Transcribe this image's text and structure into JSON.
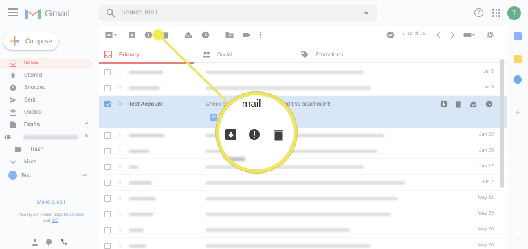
{
  "header": {
    "brand": "Gmail",
    "search_placeholder": "Search mail",
    "avatar_letter": "T"
  },
  "sidebar": {
    "compose_label": "Compose",
    "items": [
      {
        "label": "Inbox",
        "count": "",
        "icon": "inbox-icon",
        "active": true
      },
      {
        "label": "Starred",
        "count": "",
        "icon": "star-icon"
      },
      {
        "label": "Snoozed",
        "count": "",
        "icon": "clock-icon"
      },
      {
        "label": "Sent",
        "count": "",
        "icon": "send-icon"
      },
      {
        "label": "Outbox",
        "count": "",
        "icon": "outbox-icon"
      },
      {
        "label": "Drafts",
        "count": "4",
        "icon": "draft-icon"
      },
      {
        "label": "",
        "count": "6",
        "icon": "label-icon"
      },
      {
        "label": "Trash",
        "count": "",
        "icon": "label-icon"
      },
      {
        "label": "More",
        "count": "",
        "icon": "chevron-down-icon"
      }
    ],
    "user_name": "Test",
    "make_call": "Make a call",
    "apps_note_prefix": "Also try our mobile apps for",
    "apps_android": "Android",
    "apps_and": "and",
    "apps_ios": "iOS"
  },
  "toolbar": {
    "page_count": "1–15 of 15"
  },
  "tabs": [
    {
      "label": "Primary",
      "icon": "inbox-icon",
      "active": true
    },
    {
      "label": "Social",
      "icon": "people-icon"
    },
    {
      "label": "Promotions",
      "icon": "tag-icon"
    }
  ],
  "emails": [
    {
      "date": "Jul 5"
    },
    {
      "date": "Jul 3"
    },
    {
      "sender": "Test Account",
      "subject": "Check out this mail: hey, download this attachment!",
      "selected": true,
      "attachment_label": "W"
    },
    {
      "date": "Jun 22"
    },
    {
      "date": "Jun 20"
    },
    {
      "date": "Jun 17"
    },
    {
      "date": "Jun 7"
    },
    {
      "date": "May 31"
    },
    {
      "date": "May 29"
    },
    {
      "date": "May 26"
    },
    {
      "date": "May 26"
    }
  ],
  "callout": {
    "text": "mail",
    "icons": [
      "archive-icon",
      "report-spam-icon",
      "delete-icon"
    ]
  },
  "colors": {
    "accent_red": "#d93025",
    "selected_row": "#c2d7f2",
    "callout_yellow": "#ede46a"
  }
}
